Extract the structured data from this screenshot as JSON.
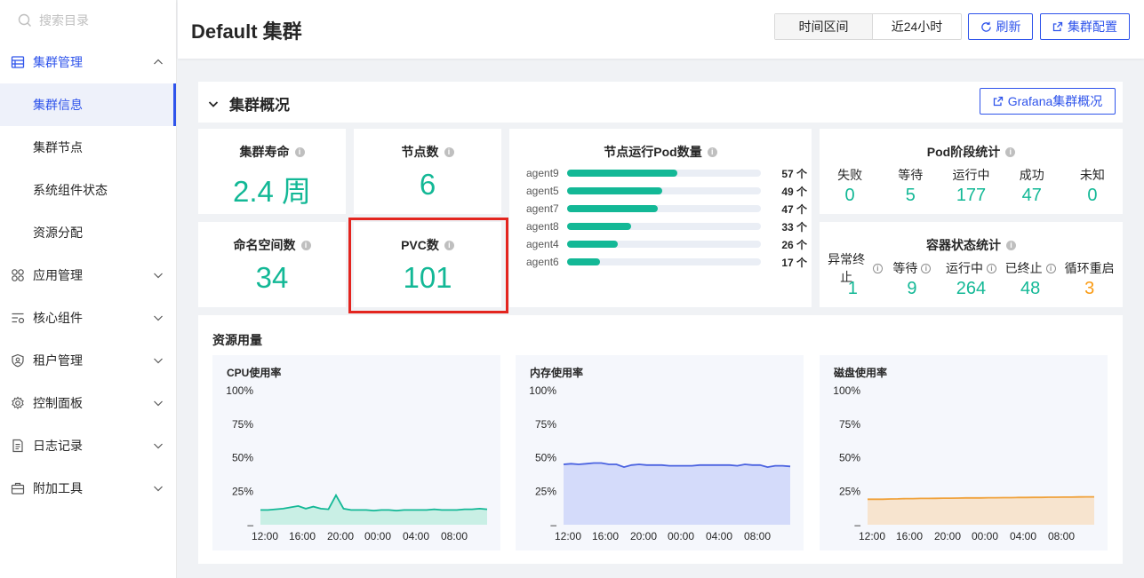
{
  "sidebar": {
    "search_placeholder": "搜索目录",
    "items": [
      {
        "label": "集群管理",
        "icon": "cluster-icon",
        "expanded": true,
        "children": [
          "集群信息",
          "集群节点",
          "系统组件状态",
          "资源分配"
        ]
      },
      {
        "label": "应用管理",
        "icon": "apps-icon"
      },
      {
        "label": "核心组件",
        "icon": "core-components-icon"
      },
      {
        "label": "租户管理",
        "icon": "tenant-shield-icon"
      },
      {
        "label": "控制面板",
        "icon": "gear-icon"
      },
      {
        "label": "日志记录",
        "icon": "log-document-icon"
      },
      {
        "label": "附加工具",
        "icon": "toolbox-icon"
      }
    ],
    "active_child": "集群信息"
  },
  "header": {
    "title": "Default 集群",
    "range_label": "时间区间",
    "range_value": "近24小时",
    "refresh_label": "刷新",
    "config_label": "集群配置"
  },
  "overview": {
    "title": "集群概况",
    "grafana_label": "Grafana集群概况",
    "cluster_age": {
      "label": "集群寿命",
      "value": "2.4 周"
    },
    "node_count": {
      "label": "节点数",
      "value": "6"
    },
    "namespace_count": {
      "label": "命名空间数",
      "value": "34"
    },
    "pvc_count": {
      "label": "PVC数",
      "value": "101"
    },
    "pod_per_node": {
      "title": "节点运行Pod数量",
      "max": 100,
      "rows": [
        {
          "name": "agent9",
          "value": 57,
          "label": "57 个"
        },
        {
          "name": "agent5",
          "value": 49,
          "label": "49 个"
        },
        {
          "name": "agent7",
          "value": 47,
          "label": "47 个"
        },
        {
          "name": "agent8",
          "value": 33,
          "label": "33 个"
        },
        {
          "name": "agent4",
          "value": 26,
          "label": "26 个"
        },
        {
          "name": "agent6",
          "value": 17,
          "label": "17 个"
        }
      ]
    },
    "pod_phase": {
      "title": "Pod阶段统计",
      "stats": [
        {
          "label": "失败",
          "value": "0"
        },
        {
          "label": "等待",
          "value": "5"
        },
        {
          "label": "运行中",
          "value": "177"
        },
        {
          "label": "成功",
          "value": "47"
        },
        {
          "label": "未知",
          "value": "0"
        }
      ]
    },
    "container_state": {
      "title": "容器状态统计",
      "stats": [
        {
          "label": "异常终止",
          "value": "1"
        },
        {
          "label": "等待",
          "value": "9"
        },
        {
          "label": "运行中",
          "value": "264"
        },
        {
          "label": "已终止",
          "value": "48"
        },
        {
          "label": "循环重启",
          "value": "3"
        }
      ]
    }
  },
  "resources": {
    "title": "资源用量"
  },
  "chart_data": [
    {
      "type": "area",
      "title": "CPU使用率",
      "y_ticks": [
        "100%",
        "75%",
        "50%",
        "25%",
        "–"
      ],
      "x_ticks": [
        "12:00",
        "16:00",
        "20:00",
        "00:00",
        "04:00",
        "08:00"
      ],
      "ylim": [
        0,
        100
      ],
      "color": "#13b896",
      "fill": "#c9efe5",
      "series": [
        {
          "values": [
            11,
            11,
            11.5,
            12,
            13,
            14,
            12,
            13.5,
            12,
            11.5,
            22,
            12,
            11,
            11,
            11,
            10.5,
            11,
            11,
            10.5,
            11,
            11,
            11,
            11,
            11.5,
            11,
            11,
            11,
            11.5,
            11.5,
            12,
            11.5
          ]
        }
      ]
    },
    {
      "type": "area",
      "title": "内存使用率",
      "y_ticks": [
        "100%",
        "75%",
        "50%",
        "25%",
        "–"
      ],
      "x_ticks": [
        "12:00",
        "16:00",
        "20:00",
        "00:00",
        "04:00",
        "08:00"
      ],
      "ylim": [
        0,
        100
      ],
      "color": "#4b63e0",
      "fill": "#d4dbfa",
      "series": [
        {
          "values": [
            45,
            45.5,
            45,
            45.5,
            46,
            46,
            45,
            45,
            43,
            44.5,
            45,
            44.5,
            44.5,
            44.5,
            44,
            44,
            44,
            44,
            44.5,
            44.5,
            44.5,
            44.5,
            44.5,
            44,
            45,
            44.5,
            44.5,
            43,
            44,
            44,
            43.5
          ]
        }
      ]
    },
    {
      "type": "area",
      "title": "磁盘使用率",
      "y_ticks": [
        "100%",
        "75%",
        "50%",
        "25%",
        "–"
      ],
      "x_ticks": [
        "12:00",
        "16:00",
        "20:00",
        "00:00",
        "04:00",
        "08:00"
      ],
      "ylim": [
        0,
        100
      ],
      "color": "#f0a23b",
      "fill": "#f7e4cf",
      "series": [
        {
          "values": [
            19,
            19,
            19,
            19.2,
            19.3,
            19.5,
            19.5,
            19.6,
            19.6,
            19.7,
            19.8,
            19.8,
            19.9,
            20,
            20,
            20,
            20.1,
            20.1,
            20.2,
            20.2,
            20.3,
            20.3,
            20.4,
            20.4,
            20.5,
            20.5,
            20.6,
            20.6,
            20.7,
            20.8,
            20.8
          ]
        }
      ]
    }
  ]
}
